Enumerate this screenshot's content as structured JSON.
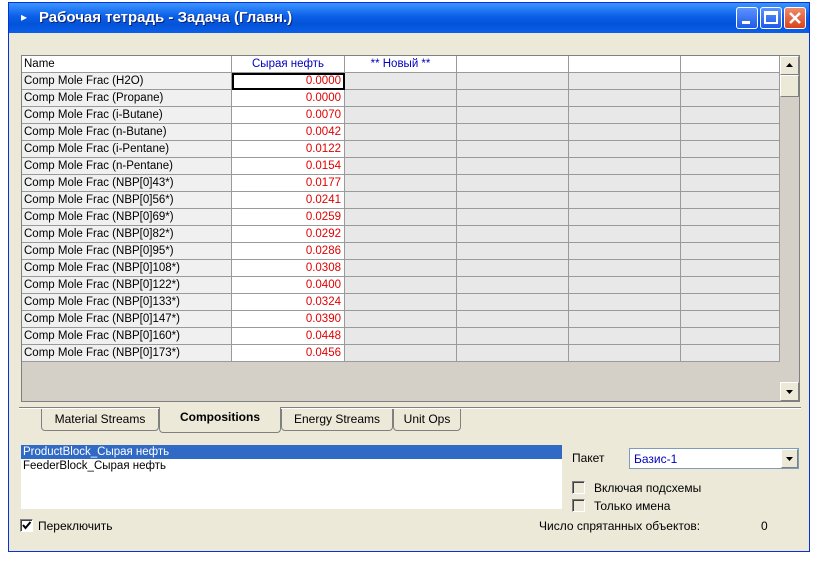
{
  "window": {
    "title": "Рабочая тетрадь - Задача (Главн.)"
  },
  "grid": {
    "headers": [
      "Name",
      "Сырая нефть",
      "** Новый **"
    ],
    "rows": [
      {
        "name": "Comp Mole Frac (H2O)",
        "value": "0.0000"
      },
      {
        "name": "Comp Mole Frac (Propane)",
        "value": "0.0000"
      },
      {
        "name": "Comp Mole Frac (i-Butane)",
        "value": "0.0070"
      },
      {
        "name": "Comp Mole Frac (n-Butane)",
        "value": "0.0042"
      },
      {
        "name": "Comp Mole Frac (i-Pentane)",
        "value": "0.0122"
      },
      {
        "name": "Comp Mole Frac (n-Pentane)",
        "value": "0.0154"
      },
      {
        "name": "Comp Mole Frac (NBP[0]43*)",
        "value": "0.0177"
      },
      {
        "name": "Comp Mole Frac (NBP[0]56*)",
        "value": "0.0241"
      },
      {
        "name": "Comp Mole Frac (NBP[0]69*)",
        "value": "0.0259"
      },
      {
        "name": "Comp Mole Frac (NBP[0]82*)",
        "value": "0.0292"
      },
      {
        "name": "Comp Mole Frac (NBP[0]95*)",
        "value": "0.0286"
      },
      {
        "name": "Comp Mole Frac (NBP[0]108*)",
        "value": "0.0308"
      },
      {
        "name": "Comp Mole Frac (NBP[0]122*)",
        "value": "0.0400"
      },
      {
        "name": "Comp Mole Frac (NBP[0]133*)",
        "value": "0.0324"
      },
      {
        "name": "Comp Mole Frac (NBP[0]147*)",
        "value": "0.0390"
      },
      {
        "name": "Comp Mole Frac (NBP[0]160*)",
        "value": "0.0448"
      },
      {
        "name": "Comp Mole Frac (NBP[0]173*)",
        "value": "0.0456"
      }
    ]
  },
  "tabs": [
    {
      "label": "Material Streams",
      "active": false
    },
    {
      "label": "Compositions",
      "active": true
    },
    {
      "label": "Energy Streams",
      "active": false
    },
    {
      "label": "Unit Ops",
      "active": false
    }
  ],
  "list": {
    "items": [
      "ProductBlock_Сырая нефть",
      "FeederBlock_Сырая нефть"
    ],
    "selected_index": 0
  },
  "package": {
    "label": "Пакет",
    "value": "Базис-1"
  },
  "options": {
    "include_subflowsheets": "Включая подсхемы",
    "names_only": "Только имена",
    "toggle": "Переключить",
    "hidden_count_label": "Число спрятанных объектов:",
    "hidden_count": "0"
  },
  "colors": {
    "value_text": "#e00000",
    "header_text": "#0000c0",
    "selection": "#316ac5",
    "titlebar": "#0a5fe8"
  }
}
